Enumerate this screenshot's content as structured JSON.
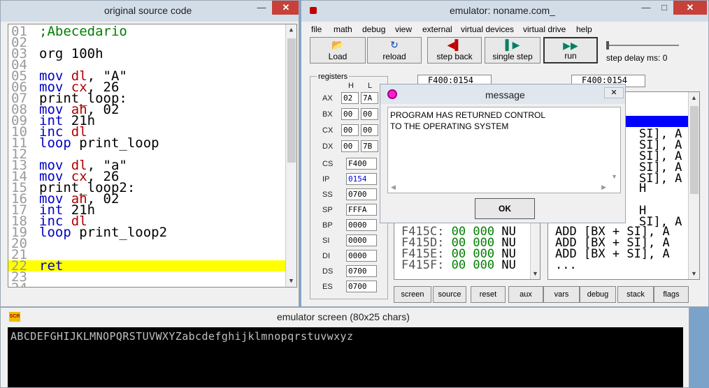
{
  "source_window": {
    "title": "original source code",
    "lines": [
      {
        "n": "01",
        "t": ";Abecedario",
        "c": "cm"
      },
      {
        "n": "02",
        "t": "",
        "c": "nm"
      },
      {
        "n": "03",
        "t": "org 100h",
        "c": "nm"
      },
      {
        "n": "04",
        "t": "",
        "c": "nm"
      },
      {
        "n": "05",
        "k": "mov",
        "r": "dl",
        "rest": ", \"A\""
      },
      {
        "n": "06",
        "k": "mov",
        "r": "cx",
        "rest": ", 26"
      },
      {
        "n": "07",
        "t": "print_loop:",
        "c": "lb"
      },
      {
        "n": "08",
        "k": "mov",
        "r": "ah",
        "rest": ", 02"
      },
      {
        "n": "09",
        "k": "int",
        "r": "",
        "rest": "21h"
      },
      {
        "n": "10",
        "k": "inc",
        "r": "dl",
        "rest": ""
      },
      {
        "n": "11",
        "k": "loop",
        "r": "",
        "rest": "print_loop"
      },
      {
        "n": "12",
        "t": "",
        "c": "nm"
      },
      {
        "n": "13",
        "k": "mov",
        "r": "dl",
        "rest": ", \"a\""
      },
      {
        "n": "14",
        "k": "mov",
        "r": "cx",
        "rest": ", 26"
      },
      {
        "n": "15",
        "t": "print_loop2:",
        "c": "lb"
      },
      {
        "n": "16",
        "k": "mov",
        "r": "ah",
        "rest": ", 02"
      },
      {
        "n": "17",
        "k": "int",
        "r": "",
        "rest": "21h"
      },
      {
        "n": "18",
        "k": "inc",
        "r": "dl",
        "rest": ""
      },
      {
        "n": "19",
        "k": "loop",
        "r": "",
        "rest": "print_loop2"
      },
      {
        "n": "20",
        "t": "",
        "c": "nm"
      },
      {
        "n": "21",
        "t": "",
        "c": "nm"
      },
      {
        "n": "22",
        "k": "ret",
        "r": "",
        "rest": "",
        "hl": true
      },
      {
        "n": "23",
        "t": "",
        "c": "nm"
      },
      {
        "n": "24",
        "t": "",
        "c": "nm"
      }
    ]
  },
  "emulator_window": {
    "title": "emulator: noname.com_",
    "menu": [
      "file",
      "math",
      "debug",
      "view",
      "external",
      "virtual devices",
      "virtual drive",
      "help"
    ],
    "toolbar": [
      {
        "label": "Load",
        "icon": "folder-icon",
        "glyph": "📂"
      },
      {
        "label": "reload",
        "icon": "reload-icon",
        "glyph": "↻"
      },
      {
        "label": "step back",
        "icon": "step-back-icon",
        "glyph": "◀▌"
      },
      {
        "label": "single step",
        "icon": "single-step-icon",
        "glyph": "▌▶"
      },
      {
        "label": "run",
        "icon": "run-icon",
        "glyph": "▶▶"
      }
    ],
    "step_delay_label": "step delay ms: 0",
    "registers_label": "registers",
    "h_label": "H",
    "l_label": "L",
    "gp_regs": [
      {
        "name": "AX",
        "h": "02",
        "l": "7A"
      },
      {
        "name": "BX",
        "h": "00",
        "l": "00"
      },
      {
        "name": "CX",
        "h": "00",
        "l": "00"
      },
      {
        "name": "DX",
        "h": "00",
        "l": "7B"
      }
    ],
    "seg_regs": [
      {
        "name": "CS",
        "v": "F400",
        "blue": false
      },
      {
        "name": "IP",
        "v": "0154",
        "blue": true
      },
      {
        "name": "SS",
        "v": "0700",
        "blue": false
      },
      {
        "name": "SP",
        "v": "FFFA",
        "blue": false
      },
      {
        "name": "BP",
        "v": "0000",
        "blue": false
      },
      {
        "name": "SI",
        "v": "0000",
        "blue": false
      },
      {
        "name": "DI",
        "v": "0000",
        "blue": false
      },
      {
        "name": "DS",
        "v": "0700",
        "blue": false
      },
      {
        "name": "ES",
        "v": "0700",
        "blue": false
      }
    ],
    "addr_left": "F400:0154",
    "addr_right": "F400:0154",
    "memory_rows": [
      {
        "addr": "F415C:",
        "a": "00",
        "b": "000",
        "c": "NU"
      },
      {
        "addr": "F415D:",
        "a": "00",
        "b": "000",
        "c": "NU"
      },
      {
        "addr": "F415E:",
        "a": "00",
        "b": "000",
        "c": "NU"
      },
      {
        "addr": "F415F:",
        "a": "00",
        "b": "000",
        "c": "NU"
      }
    ],
    "disasm_top": [
      "SI], A",
      "SI], A",
      "SI], A",
      "SI], A",
      "SI], A",
      "H",
      "H",
      "SI], A"
    ],
    "disasm_bottom": [
      "ADD [BX + SI], A",
      "ADD [BX + SI], A",
      "ADD [BX + SI], A",
      "..."
    ],
    "bottom_buttons": [
      "screen",
      "source",
      "reset",
      "aux",
      "vars",
      "debug",
      "stack",
      "flags"
    ]
  },
  "message_dialog": {
    "title": "message",
    "text_line1": "PROGRAM HAS RETURNED CONTROL",
    "text_line2": "TO THE OPERATING SYSTEM",
    "ok_label": "OK"
  },
  "screen_window": {
    "title": "emulator screen (80x25 chars)",
    "icon_text": "SCR",
    "output": "ABCDEFGHIJKLMNOPQRSTUVWXYZabcdefghijklmnopqrstuvwxyz"
  },
  "colors": {
    "highlight": "#ffff00",
    "keyword": "#0000c8",
    "register": "#b00000",
    "selection": "#0000ff"
  }
}
